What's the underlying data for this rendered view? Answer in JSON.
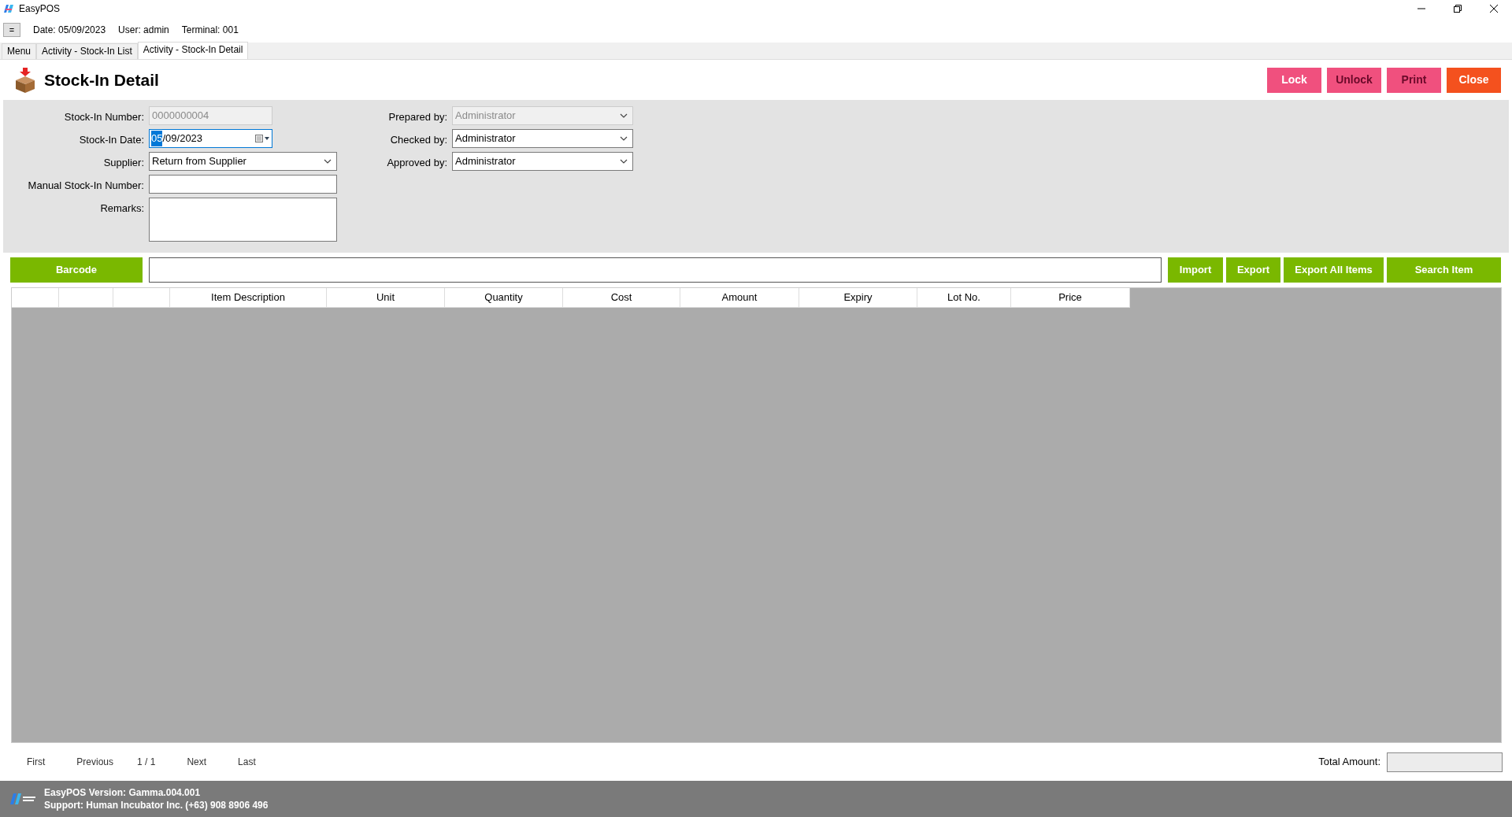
{
  "window": {
    "title": "EasyPOS"
  },
  "info_bar": {
    "menu_button": "=",
    "items": [
      "Date: 05/09/2023",
      "User: admin",
      "Terminal: 001"
    ]
  },
  "tabs": [
    {
      "label": "Menu",
      "selected": false
    },
    {
      "label": "Activity - Stock-In List",
      "selected": false
    },
    {
      "label": "Activity - Stock-In Detail",
      "selected": true
    }
  ],
  "page_title": "Stock-In Detail",
  "actions": [
    {
      "label": "Lock",
      "color": "#f0507e",
      "disabled": false
    },
    {
      "label": "Unlock",
      "color": "#f0507e",
      "disabled": true
    },
    {
      "label": "Print",
      "color": "#f0507e",
      "disabled": true
    },
    {
      "label": "Close",
      "color": "#f4511e",
      "disabled": false
    }
  ],
  "form_left": [
    {
      "kind": "text",
      "label": "Stock-In Number:",
      "value": "0000000004",
      "disabled": true
    },
    {
      "kind": "date",
      "label": "Stock-In Date:",
      "value_parts": [
        {
          "text": "05",
          "selected": true
        },
        {
          "text": "/09/2023",
          "selected": false
        }
      ],
      "disabled": false
    },
    {
      "kind": "select",
      "label": "Supplier:",
      "value": "Return from Supplier",
      "disabled": false
    },
    {
      "kind": "text",
      "label": "Manual Stock-In Number:",
      "disabled": false
    },
    {
      "kind": "textarea",
      "label": "Remarks:",
      "disabled": false
    }
  ],
  "form_right": [
    {
      "kind": "select",
      "label": "Prepared by:",
      "value": "Administrator",
      "disabled": true
    },
    {
      "kind": "select",
      "label": "Checked by:",
      "value": "Administrator",
      "disabled": false
    },
    {
      "kind": "select",
      "label": "Approved by:",
      "value": "Administrator",
      "disabled": false
    }
  ],
  "barcode_button": "Barcode",
  "item_buttons": [
    "Import",
    "Export",
    "Export All Items",
    "Search Item"
  ],
  "table": {
    "columns": [
      {
        "kind": "blank"
      },
      {
        "kind": "blank"
      },
      {
        "kind": "blank"
      },
      {
        "kind": "text",
        "label": "Item Description"
      },
      {
        "kind": "text",
        "label": "Unit"
      },
      {
        "kind": "text",
        "label": "Quantity"
      },
      {
        "kind": "text",
        "label": "Cost"
      },
      {
        "kind": "text",
        "label": "Amount"
      },
      {
        "kind": "text",
        "label": "Expiry"
      },
      {
        "kind": "text",
        "label": "Lot No."
      },
      {
        "kind": "text",
        "label": "Price"
      }
    ]
  },
  "pagination": {
    "first": "First",
    "previous": "Previous",
    "page": "1 / 1",
    "next": "Next",
    "last": "Last"
  },
  "total": {
    "label": "Total Amount:"
  },
  "status_bar": {
    "lines": [
      "EasyPOS Version: Gamma.004.001",
      "Support: Human Incubator Inc. (+63) 908 8906 496"
    ]
  }
}
